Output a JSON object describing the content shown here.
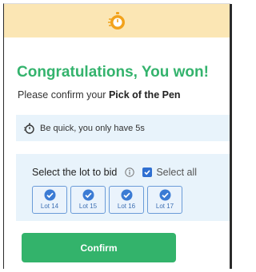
{
  "dialog": {
    "title": "Congratulations, You won!",
    "subtitle_prefix": "Please confirm your ",
    "subtitle_bold": "Pick of the Pen"
  },
  "notice": {
    "text": "Be quick, you only have 5s"
  },
  "selection": {
    "label": "Select the lot to bid",
    "select_all_label": "Select all",
    "select_all_checked": true,
    "lots": [
      {
        "label": "Lot 14",
        "checked": true
      },
      {
        "label": "Lot 15",
        "checked": true
      },
      {
        "label": "Lot 16",
        "checked": true
      },
      {
        "label": "Lot 17",
        "checked": true
      }
    ]
  },
  "actions": {
    "confirm_label": "Confirm"
  },
  "colors": {
    "header_bg": "#fbe6b4",
    "accent_green": "#34b36d",
    "timer_orange": "#f2a21b",
    "check_blue": "#2f6fd1",
    "panel_bg": "#e8f3fb"
  },
  "icons": {
    "header": "stopwatch-icon",
    "notice": "stopwatch-icon",
    "info": "info-icon",
    "lot_check": "check-circle-icon"
  }
}
